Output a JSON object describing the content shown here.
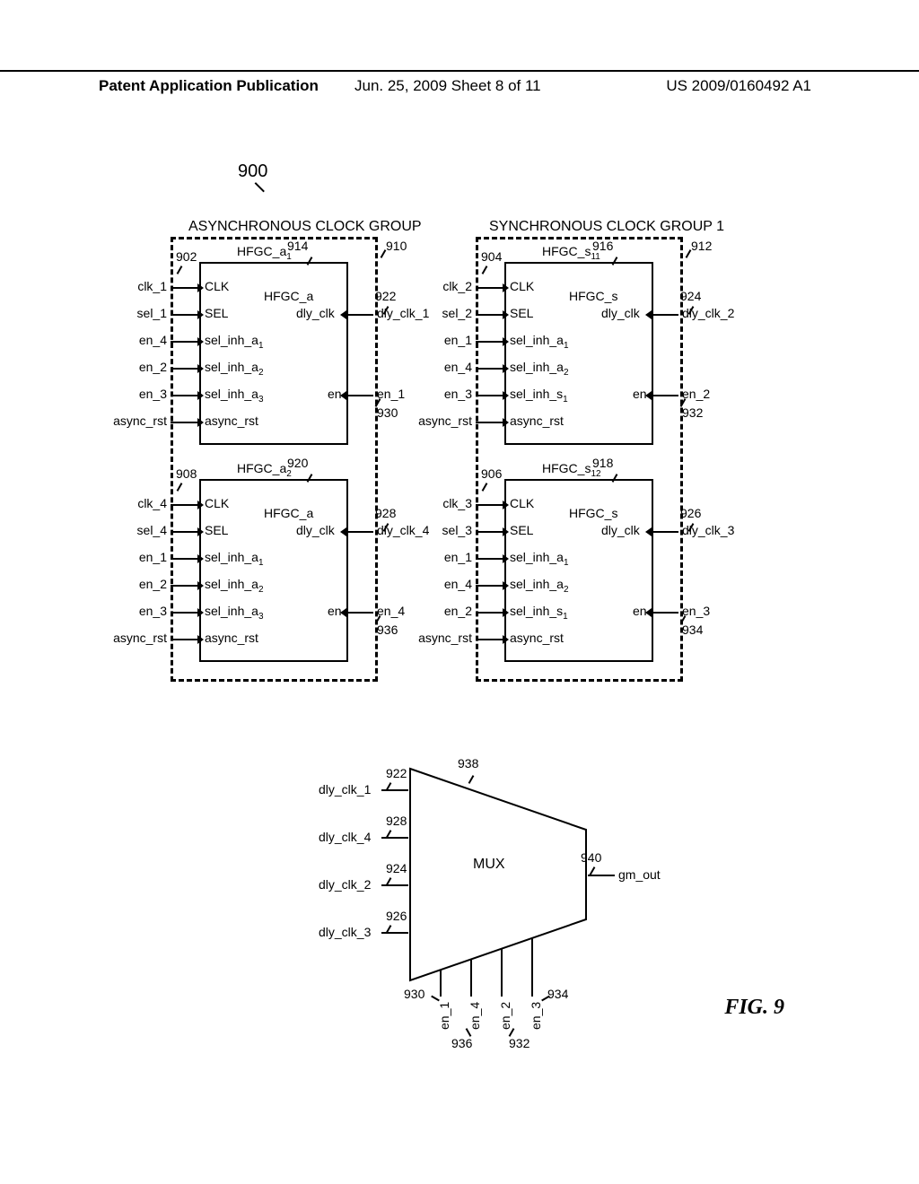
{
  "header": {
    "left": "Patent Application Publication",
    "mid": "Jun. 25, 2009  Sheet 8 of 11",
    "right": "US 2009/0160492 A1"
  },
  "figure_label": "FIG. 9",
  "top_ref": "900",
  "group_titles": {
    "async": "ASYNCHRONOUS CLOCK GROUP",
    "sync": "SYNCHRONOUS CLOCK GROUP 1"
  },
  "refs": {
    "group_async_lead": "910",
    "group_sync_lead": "912",
    "a1_bus": "902",
    "a1_blk": "914",
    "a1_dly": "922",
    "a1_en": "930",
    "a2_bus": "908",
    "a2_blk": "920",
    "a2_dly": "928",
    "a2_en": "936",
    "s11_bus": "904",
    "s11_blk": "916",
    "s11_dly": "924",
    "s11_en": "932",
    "s12_bus": "906",
    "s12_blk": "918",
    "s12_dly": "926",
    "s12_en": "934",
    "mux_top": "922",
    "mux_938": "938",
    "mux_dly4": "928",
    "mux_dly2": "924",
    "mux_dly3": "926",
    "mux_sel1": "930",
    "mux_sel4": "936",
    "mux_sel2": "932",
    "mux_sel3": "934",
    "mux_out": "940"
  },
  "a1": {
    "title_top": "HFGC_a",
    "title_top_sub": "1",
    "title_inner": "HFGC_a",
    "ports_left": [
      "CLK",
      "SEL",
      "sel_inh_a",
      "sel_inh_a",
      "sel_inh_a",
      "async_rst"
    ],
    "ports_left_sub": [
      "",
      "",
      "1",
      "2",
      "3",
      ""
    ],
    "ext_left": [
      "clk_1",
      "sel_1",
      "en_4",
      "en_2",
      "en_3",
      "async_rst"
    ],
    "ports_right": [
      "dly_clk",
      "en"
    ],
    "ext_right": [
      "dly_clk_1",
      "en_1"
    ]
  },
  "a2": {
    "title_top": "HFGC_a",
    "title_top_sub": "2",
    "title_inner": "HFGC_a",
    "ports_left": [
      "CLK",
      "SEL",
      "sel_inh_a",
      "sel_inh_a",
      "sel_inh_a",
      "async_rst"
    ],
    "ports_left_sub": [
      "",
      "",
      "1",
      "2",
      "3",
      ""
    ],
    "ext_left": [
      "clk_4",
      "sel_4",
      "en_1",
      "en_2",
      "en_3",
      "async_rst"
    ],
    "ports_right": [
      "dly_clk",
      "en"
    ],
    "ext_right": [
      "dly_clk_4",
      "en_4"
    ]
  },
  "s11": {
    "title_top": "HFGC_s",
    "title_top_sub": "11",
    "title_inner": "HFGC_s",
    "ports_left": [
      "CLK",
      "SEL",
      "sel_inh_a",
      "sel_inh_a",
      "sel_inh_s",
      "async_rst"
    ],
    "ports_left_sub": [
      "",
      "",
      "1",
      "2",
      "1",
      ""
    ],
    "ext_left": [
      "clk_2",
      "sel_2",
      "en_1",
      "en_4",
      "en_3",
      "async_rst"
    ],
    "ports_right": [
      "dly_clk",
      "en"
    ],
    "ext_right": [
      "dly_clk_2",
      "en_2"
    ]
  },
  "s12": {
    "title_top": "HFGC_s",
    "title_top_sub": "12",
    "title_inner": "HFGC_s",
    "ports_left": [
      "CLK",
      "SEL",
      "sel_inh_a",
      "sel_inh_a",
      "sel_inh_s",
      "async_rst"
    ],
    "ports_left_sub": [
      "",
      "",
      "1",
      "2",
      "1",
      ""
    ],
    "ext_left": [
      "clk_3",
      "sel_3",
      "en_1",
      "en_4",
      "en_2",
      "async_rst"
    ],
    "ports_right": [
      "dly_clk",
      "en"
    ],
    "ext_right": [
      "dly_clk_3",
      "en_3"
    ]
  },
  "mux": {
    "label": "MUX",
    "inputs": [
      "dly_clk_1",
      "dly_clk_4",
      "dly_clk_2",
      "dly_clk_3"
    ],
    "sel": [
      "en_1",
      "en_4",
      "en_2",
      "en_3"
    ],
    "out": "gm_out"
  }
}
